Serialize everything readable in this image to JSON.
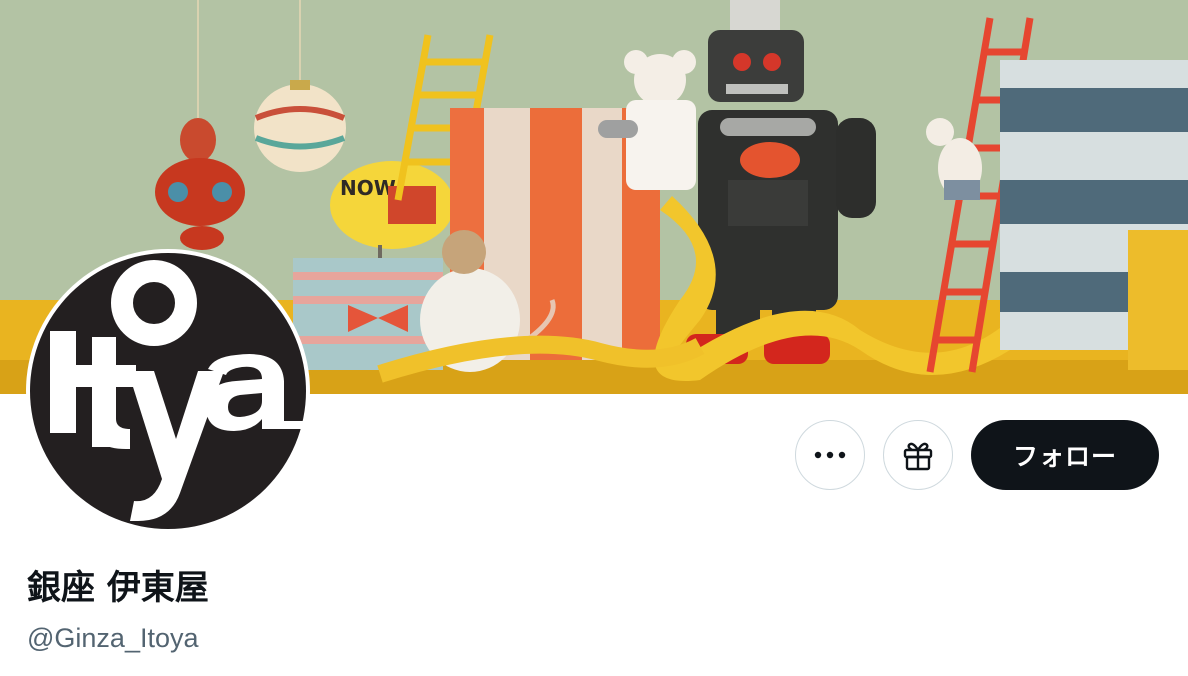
{
  "banner": {
    "sign_text": "NOW!"
  },
  "avatar": {
    "logo_text": "Itoya"
  },
  "actions": {
    "more_icon": "more-horizontal-icon",
    "gift_icon": "gift-icon",
    "follow_label": "フォロー"
  },
  "profile": {
    "display_name": "銀座 伊東屋",
    "handle": "@Ginza_Itoya"
  },
  "colors": {
    "follow_bg": "#0f1419",
    "handle_text": "#536471",
    "button_border": "#cfd9de"
  }
}
